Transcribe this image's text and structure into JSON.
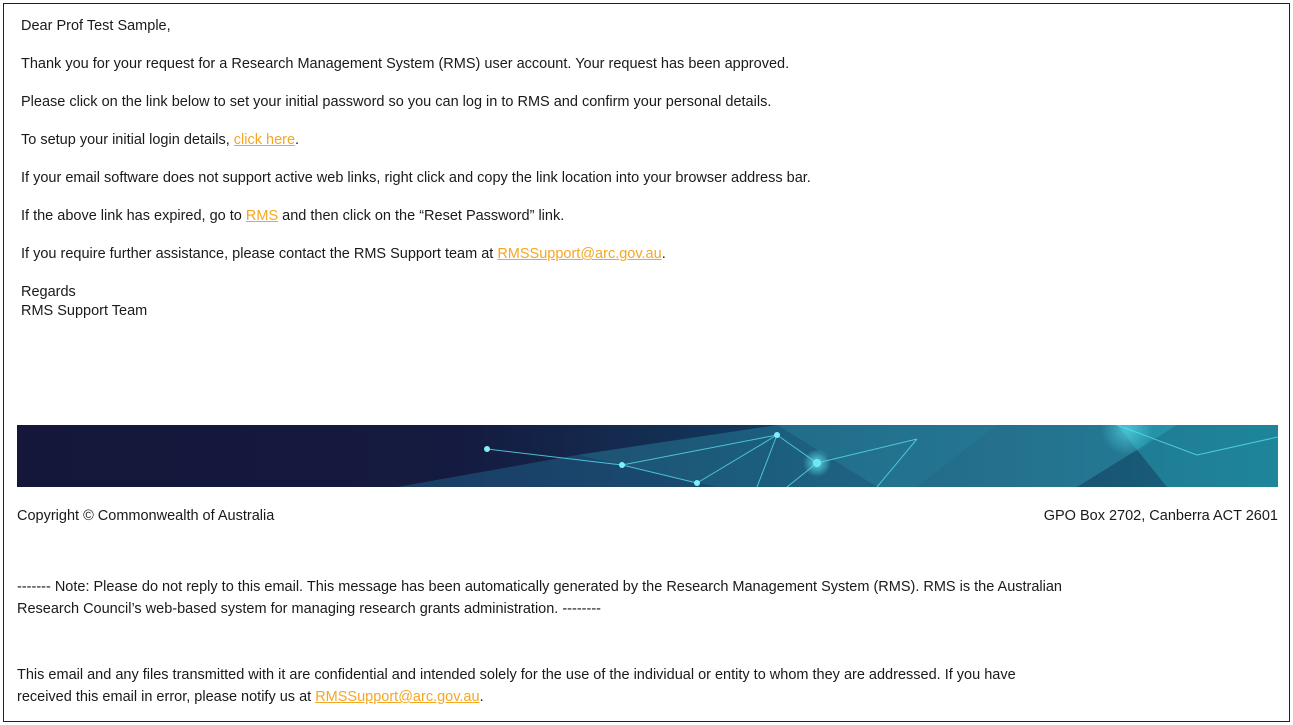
{
  "email": {
    "greeting": "Dear Prof Test Sample,",
    "para1": "Thank you for your request for a Research Management System (RMS) user account. Your request has been approved.",
    "para2": "Please click on the link below to set your initial password so you can log in to RMS and confirm your personal details.",
    "para3_prefix": "To setup your initial login details, ",
    "para3_link": "click here",
    "para3_suffix": ".",
    "para4": "If your email software does not support active web links, right click and copy the link location into your browser address bar.",
    "para5_prefix": "If the above link has expired, go to ",
    "para5_link": "RMS",
    "para5_suffix": " and then click on the “Reset Password” link.",
    "para6_prefix": "If you require further assistance, please contact the RMS Support team at ",
    "para6_link": "RMSSupport@arc.gov.au",
    "para6_suffix": ".",
    "signoff": "Regards",
    "signature": "RMS Support Team"
  },
  "footer": {
    "copyright": "Copyright © Commonwealth of Australia",
    "address": "GPO Box 2702, Canberra ACT 2601",
    "note_line1": "------- Note: Please do not reply to this email. This message has been automatically generated by the Research Management System (RMS). RMS is the Australian",
    "note_line2": "Research Council’s web-based system for managing research grants administration. --------",
    "confidential_line1": "This email and any files transmitted with it are confidential and intended solely for the use of the individual or entity to whom they are addressed. If you have",
    "confidential_line2_prefix": "received this email in error, please notify us at ",
    "confidential_link": "RMSSupport@arc.gov.au",
    "confidential_suffix": "."
  },
  "colors": {
    "link": "#f5a623",
    "banner_bg": "#161a3e",
    "banner_accent": "#2ec4d6"
  }
}
